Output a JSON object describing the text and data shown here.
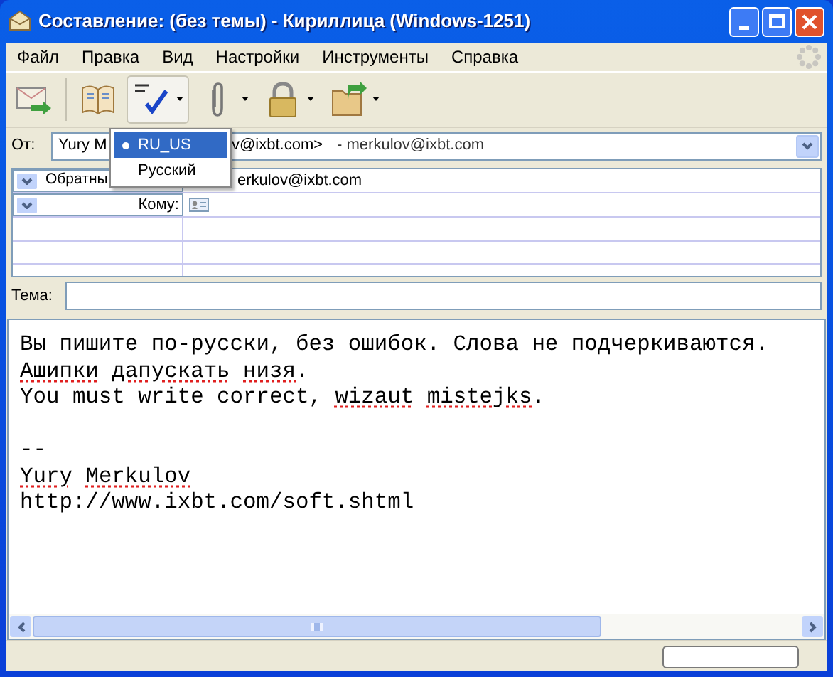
{
  "window": {
    "title": "Составление: (без темы) - Кириллица (Windows-1251)"
  },
  "menu": [
    {
      "label": "Файл"
    },
    {
      "label": "Правка"
    },
    {
      "label": "Вид"
    },
    {
      "label": "Настройки"
    },
    {
      "label": "Инструменты"
    },
    {
      "label": "Справка"
    }
  ],
  "toolbar": [
    {
      "kind": "send",
      "dropdown": false,
      "pressed": false
    },
    {
      "kind": "address-book",
      "dropdown": false,
      "pressed": false
    },
    {
      "kind": "spell",
      "dropdown": true,
      "pressed": true
    },
    {
      "kind": "attach",
      "dropdown": true,
      "pressed": false
    },
    {
      "kind": "security",
      "dropdown": true,
      "pressed": false
    },
    {
      "kind": "save",
      "dropdown": true,
      "pressed": false
    }
  ],
  "spell_menu": [
    {
      "label": "RU_US",
      "selected": true
    },
    {
      "label": "Русский",
      "selected": false
    }
  ],
  "from": {
    "label": "От:",
    "value_start": "Yury M",
    "value_end": "v@ixbt.com>",
    "account": "- merkulov@ixbt.com"
  },
  "recipients": [
    {
      "type": "Обратны",
      "address": "erkulov@ixbt.com"
    },
    {
      "type": "Кому:"
    }
  ],
  "subject": {
    "label": "Тема:"
  },
  "body": [
    {
      "gap_before": false,
      "words": [
        {
          "text": "Вы пишите по-русски, без ошибок. Слова не подчеркиваются.",
          "misspelled": false
        }
      ]
    },
    {
      "gap_before": false,
      "words": [
        {
          "text": "Ашипки",
          "misspelled": true
        },
        {
          "text": "дапускать",
          "misspelled": true
        },
        {
          "text": "низя",
          "misspelled": true,
          "after": "."
        }
      ]
    },
    {
      "gap_before": false,
      "words": [
        {
          "text": "You must write correct,",
          "misspelled": false
        },
        {
          "text": "wizaut",
          "misspelled": true
        },
        {
          "text": "mistejks",
          "misspelled": true,
          "after": "."
        }
      ]
    },
    {
      "gap_before": true,
      "words": [
        {
          "text": "--",
          "misspelled": false
        }
      ]
    },
    {
      "gap_before": false,
      "words": [
        {
          "text": "Yury",
          "misspelled": true
        },
        {
          "text": "Merkulov",
          "misspelled": true
        }
      ]
    },
    {
      "gap_before": false,
      "words": [
        {
          "text": "http://www.ixbt.com/soft.shtml",
          "misspelled": false
        }
      ]
    }
  ]
}
